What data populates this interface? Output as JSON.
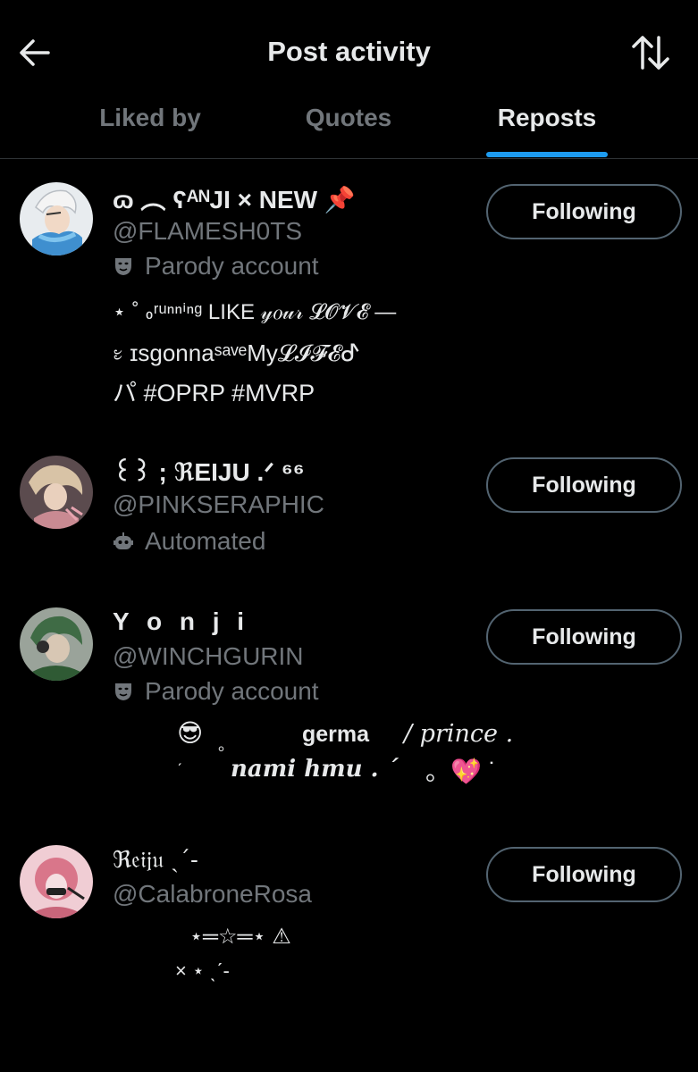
{
  "header": {
    "title": "Post activity"
  },
  "tabs": [
    {
      "label": "Liked by"
    },
    {
      "label": "Quotes"
    },
    {
      "label": "Reposts"
    }
  ],
  "users": [
    {
      "name": "ɷ ︵ ʕᴬᴺJI × NEW 📌",
      "handle": "@FLAMESH0TS",
      "label": "Parody account",
      "bio1": "⋆ ˚ ៰ʳᵘⁿⁿⁱⁿᵍ LIKE 𝓎𝑜𝓊𝓇 𝓛𝓞𝓥𝓔 —",
      "bio2": "᭝ ɪsgonnaˢᵃᵛᵉMy𝓛𝓘𝓕𝓔ᕷ",
      "bio3": "パ #OPRP #MVRP",
      "follow": "Following"
    },
    {
      "name": "꒰꒱ ; ℜEIJU .ᐟ ⁶⁶",
      "handle": "@PINKSERAPHIC",
      "label": "Automated",
      "follow": "Following"
    },
    {
      "name": "Y o n j i",
      "handle": "@WINCHGURIN",
      "label": "Parody account",
      "bio1a": "😎",
      "bio1b": "。",
      "bio1c": "germa",
      "bio1d": "/ 𝑝𝑟𝑖𝑛𝑐𝑒 .",
      "bio2a": "ˊ",
      "bio2b": "nami hmu . ˊ",
      "bio2c": "。💖 ˙",
      "follow": "Following"
    },
    {
      "name": "ℜ𝔢𝔦𝔧𝔲 ˎˊ-",
      "handle": "@CalabroneRosa",
      "bio1": "⋆═☆═⋆      ⚠",
      "bio2": "× ⋆ ˎˊ-",
      "follow": "Following"
    }
  ]
}
